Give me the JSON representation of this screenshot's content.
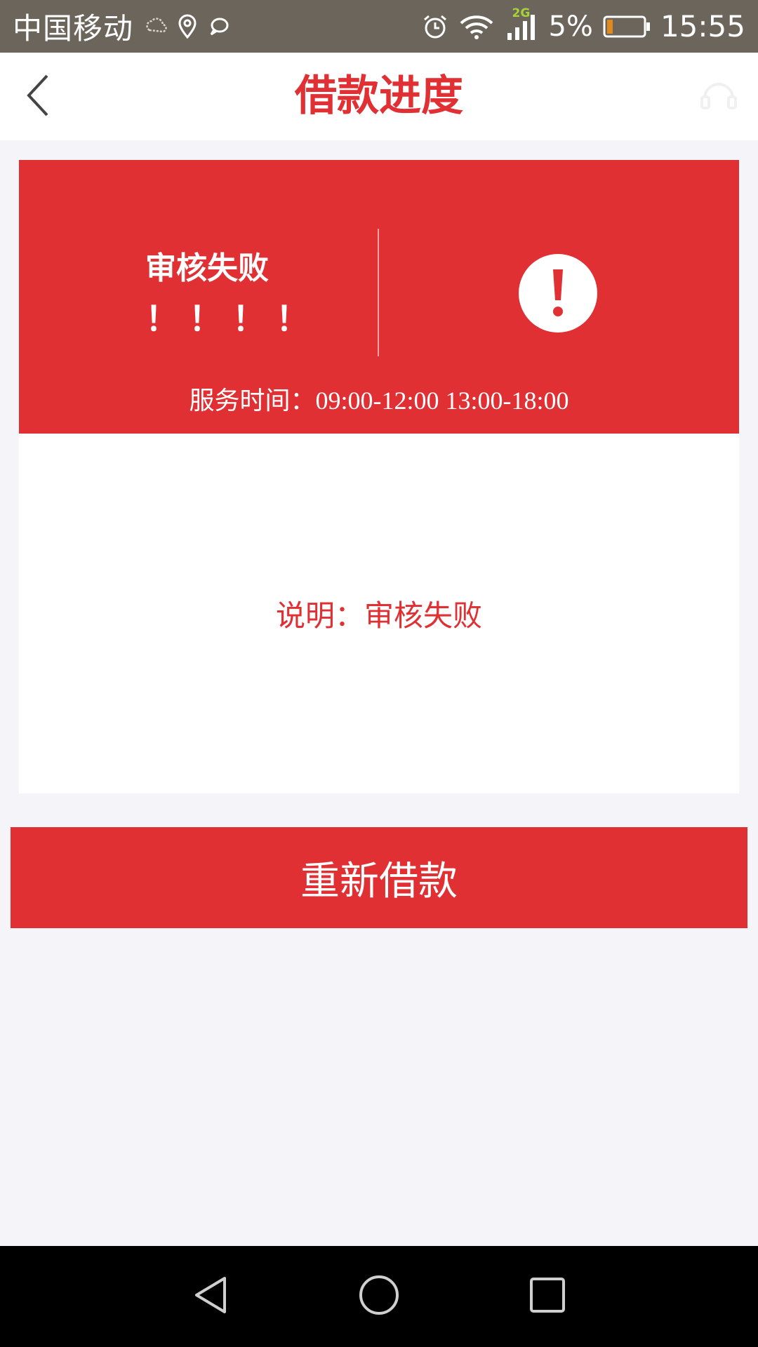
{
  "status_bar": {
    "carrier": "中国移动",
    "network_type": "2G",
    "battery": "5%",
    "time": "15:55",
    "icons": [
      "weather-icon",
      "location-icon",
      "message-icon",
      "alarm-icon",
      "wifi-icon",
      "signal-icon",
      "battery-icon"
    ]
  },
  "header": {
    "title": "借款进度",
    "icons": [
      "back-arrow-icon",
      "customer-service-icon"
    ]
  },
  "status_card": {
    "title": "审核失败",
    "marks": "！！！！",
    "service_hours": "服务时间：09:00-12:00 13:00-18:00",
    "icon": "exclamation-circle-icon",
    "accent_color": "#e03034"
  },
  "description": {
    "text": "说明：审核失败"
  },
  "action": {
    "button_label": "重新借款"
  },
  "system_nav": {
    "icons": [
      "nav-back-icon",
      "nav-home-icon",
      "nav-recents-icon"
    ]
  }
}
